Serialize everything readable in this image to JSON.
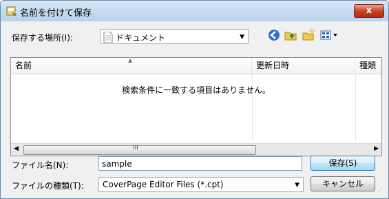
{
  "window": {
    "title": "名前を付けて保存",
    "close_label": "x"
  },
  "location": {
    "label": "保存する場所(I):",
    "value": "ドキュメント"
  },
  "toolbar": {
    "icons": [
      "back-icon",
      "up-folder-icon",
      "new-folder-icon",
      "view-menu-icon"
    ]
  },
  "filelist": {
    "columns": [
      "名前",
      "更新日時",
      "種類"
    ],
    "empty_message": "検索条件に一致する項目はありません。"
  },
  "filename": {
    "label": "ファイル名(N):",
    "value": "sample"
  },
  "filetype": {
    "label": "ファイルの種類(T):",
    "value": "CoverPage Editor Files (*.cpt)"
  },
  "buttons": {
    "save": "保存(S)",
    "cancel": "キャンセル"
  },
  "scrollbar": {
    "grip": "III"
  }
}
